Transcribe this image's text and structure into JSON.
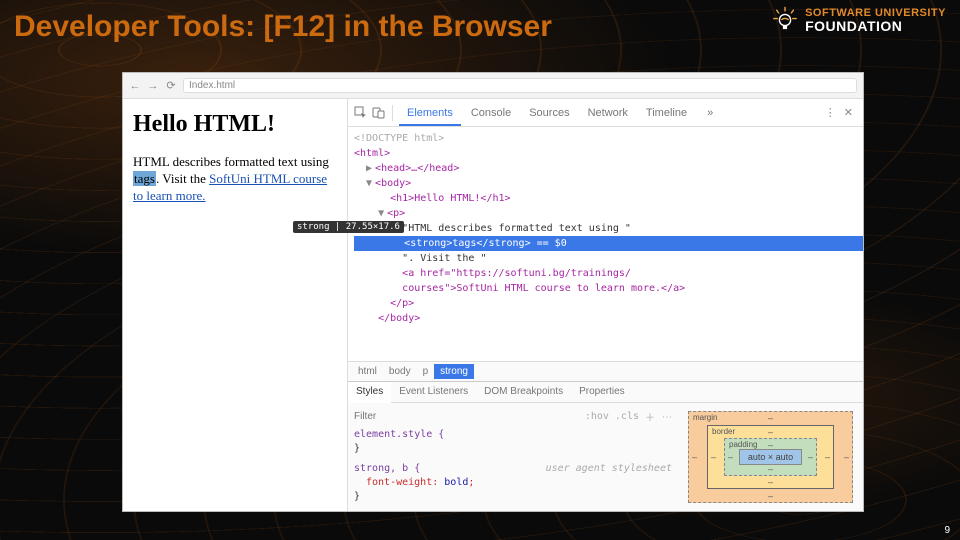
{
  "slide": {
    "title": "Developer Tools: [F12] in the Browser",
    "page_number": "9"
  },
  "logo": {
    "top": "SOFTWARE UNIVERSITY",
    "bottom": "FOUNDATION"
  },
  "browser": {
    "url": "Index.html",
    "page": {
      "heading": "Hello HTML!",
      "text_before": "HTML describes formatted text using ",
      "highlight_word": "tags",
      "text_mid": ". Visit the ",
      "link_text": "SoftUni HTML course to learn more.",
      "inspect_tooltip": "strong | 27.55×17.6"
    }
  },
  "devtools": {
    "tabs": [
      "Elements",
      "Console",
      "Sources",
      "Network",
      "Timeline"
    ],
    "more": "»",
    "dom": {
      "doctype": "<!DOCTYPE html>",
      "html_open": "<html>",
      "head": "<head>…</head>",
      "body_open": "<body>",
      "h1": "<h1>Hello HTML!</h1>",
      "p_open": "<p>",
      "txt1": "\"HTML describes formatted text using \"",
      "strong_line": "<strong>tags</strong> == $0",
      "txt2": "\". Visit the \"",
      "a_open": "<a href=\"https://softuni.bg/trainings/",
      "a_rest": "courses\">SoftUni HTML course to learn more.</a>",
      "p_close": "</p>",
      "body_close": "</body>"
    },
    "breadcrumb": [
      "html",
      "body",
      "p",
      "strong"
    ],
    "styles": {
      "tabs": [
        "Styles",
        "Event Listeners",
        "DOM Breakpoints",
        "Properties"
      ],
      "filter_placeholder": "Filter",
      "hov": ":hov",
      "cls": ".cls",
      "rule1_sel": "element.style {",
      "rule1_close": "}",
      "rule2_sel": "strong, b {",
      "rule2_uas": "user agent stylesheet",
      "rule2_prop": "font-weight",
      "rule2_val": "bold",
      "rule2_close": "}"
    },
    "box": {
      "margin": "margin",
      "border": "border",
      "padding": "padding",
      "content": "auto × auto",
      "dash": "–"
    }
  }
}
